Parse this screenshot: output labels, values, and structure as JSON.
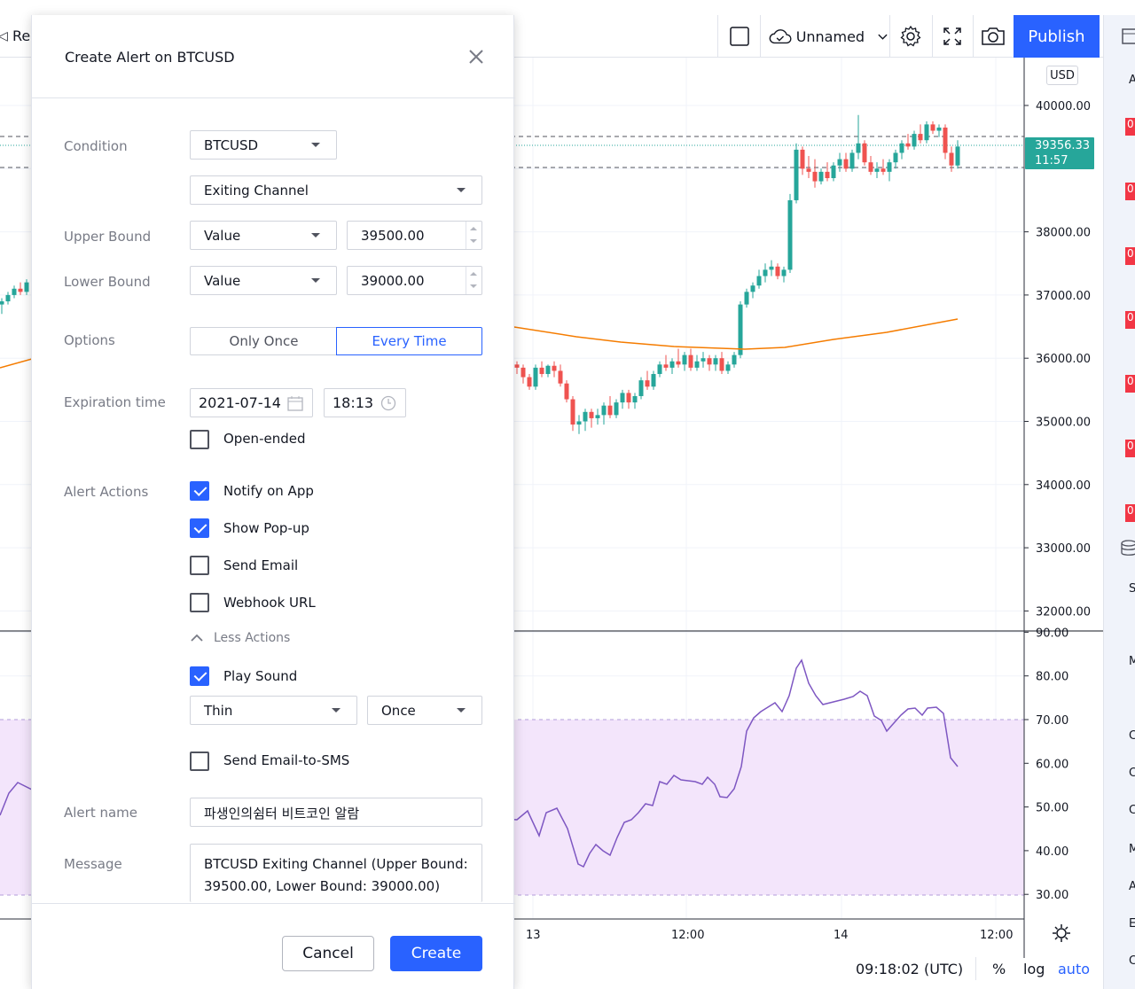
{
  "toolbar": {
    "replay_label": "Rep",
    "layout_name": "Unnamed",
    "publish_label": "Publish"
  },
  "right_toolbar": {
    "badges": [
      "0",
      "0",
      "0",
      "0",
      "0",
      "0",
      "0"
    ],
    "letters": [
      "A",
      "S",
      "M",
      "C",
      "C",
      "C",
      "M",
      "A",
      "E",
      "C"
    ]
  },
  "chart": {
    "currency": "USD",
    "last_price": "39356.33",
    "countdown": "11:57",
    "price_ticks": [
      "40000.00",
      "38000.00",
      "37000.00",
      "36000.00",
      "35000.00",
      "34000.00",
      "33000.00",
      "32000.00"
    ],
    "rsi_ticks": [
      "90.00",
      "80.00",
      "70.00",
      "60.00",
      "50.00",
      "40.00",
      "30.00"
    ],
    "time_ticks": [
      "13",
      "12:00",
      "14",
      "12:00"
    ],
    "colors": {
      "up": "#26a69a",
      "down": "#ef5350",
      "ma": "#f57c00",
      "rsi": "#7e57c2",
      "rsi_band": "#f3e5fb"
    }
  },
  "statusbar": {
    "time": "09:18:02 (UTC)",
    "percent": "%",
    "log": "log",
    "auto": "auto"
  },
  "dialog": {
    "title": "Create Alert on BTCUSD",
    "labels": {
      "condition": "Condition",
      "upper_bound": "Upper Bound",
      "lower_bound": "Lower Bound",
      "options": "Options",
      "expiration": "Expiration time",
      "alert_actions": "Alert Actions",
      "alert_name": "Alert name",
      "message": "Message"
    },
    "condition_symbol": "BTCUSD",
    "condition_type": "Exiting Channel",
    "upper_mode": "Value",
    "upper_value": "39500.00",
    "lower_mode": "Value",
    "lower_value": "39000.00",
    "options": {
      "once": "Only Once",
      "every": "Every Time",
      "selected": "Every Time"
    },
    "expiration_date": "2021-07-14",
    "expiration_time": "18:13",
    "open_ended": "Open-ended",
    "actions": {
      "notify_app": "Notify on App",
      "show_popup": "Show Pop-up",
      "send_email": "Send Email",
      "webhook": "Webhook URL",
      "less_actions": "Less Actions",
      "play_sound": "Play Sound",
      "sound_name": "Thin",
      "sound_repeat": "Once",
      "email_sms": "Send Email-to-SMS"
    },
    "checked": {
      "open_ended": false,
      "notify_app": true,
      "show_popup": true,
      "send_email": false,
      "webhook": false,
      "play_sound": true,
      "email_sms": false
    },
    "alert_name": "파생인의쉼터 비트코인 알람",
    "message": "BTCUSD Exiting Channel (Upper Bound: 39500.00, Lower Bound: 39000.00)",
    "cancel": "Cancel",
    "create": "Create"
  }
}
